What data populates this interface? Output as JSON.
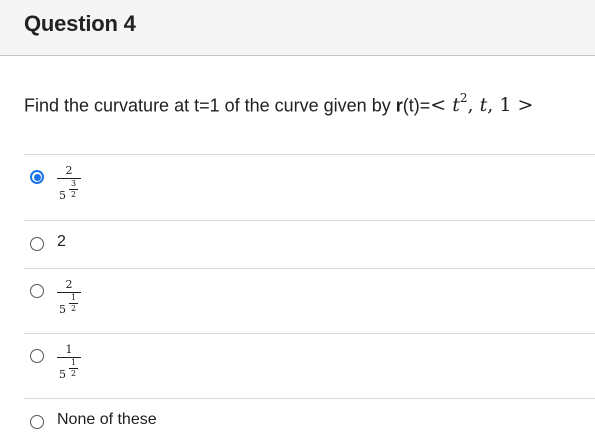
{
  "header": {
    "title": "Question 4"
  },
  "question": {
    "prefix": "Find the curvature at t=1 of the curve given by ",
    "bold_r": "r",
    "suffix": "(t)=",
    "math": {
      "lt": "<",
      "t1": "t",
      "exp": "2",
      "comma1": ",",
      "t2": "t",
      "comma2": ",",
      "one": "1",
      "gt": ">"
    }
  },
  "answers": [
    {
      "num": "2",
      "den_base": "5",
      "exp_num": "3",
      "exp_den": "2",
      "selected": true
    },
    {
      "text": "2",
      "selected": false
    },
    {
      "num": "2",
      "den_base": "5",
      "exp_num": "1",
      "exp_den": "2",
      "selected": false
    },
    {
      "num": "1",
      "den_base": "5",
      "exp_num": "1",
      "exp_den": "2",
      "selected": false
    },
    {
      "text": "None of these",
      "selected": false
    }
  ]
}
